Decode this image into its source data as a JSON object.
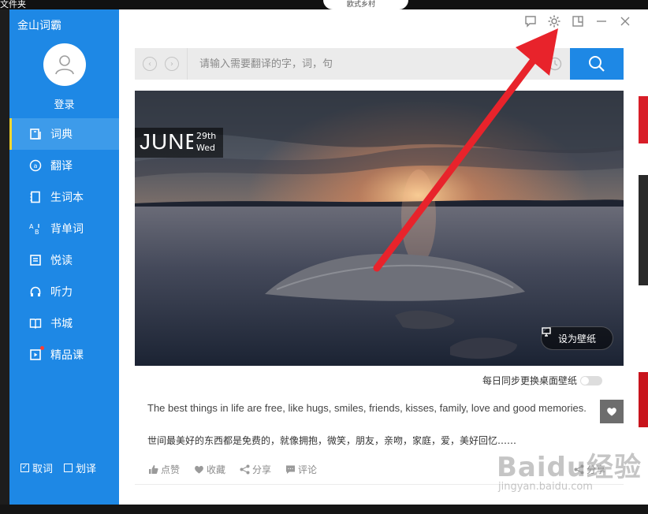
{
  "desktop": {
    "top_left_label": "文件夹",
    "top_tab_text": "欧式乡村"
  },
  "app": {
    "title": "金山词霸",
    "login_label": "登录",
    "nav_items": [
      {
        "label": "词典",
        "icon": "dictionary-icon",
        "active": true
      },
      {
        "label": "翻译",
        "icon": "translate-icon"
      },
      {
        "label": "生词本",
        "icon": "wordbook-icon"
      },
      {
        "label": "背单词",
        "icon": "memorize-icon"
      },
      {
        "label": "悦读",
        "icon": "reading-icon"
      },
      {
        "label": "听力",
        "icon": "headphones-icon"
      },
      {
        "label": "书城",
        "icon": "bookstore-icon"
      },
      {
        "label": "精品课",
        "icon": "course-icon"
      }
    ],
    "bottom_options": [
      {
        "label": "取词",
        "checked": true
      },
      {
        "label": "划译",
        "checked": false
      }
    ],
    "accent_color": "#1e88e5"
  },
  "search": {
    "placeholder": "请输入需要翻译的字，词，句"
  },
  "hero": {
    "month": "JUNE",
    "day": "29th",
    "weekday": "Wed",
    "wallpaper_button": "设为壁纸",
    "sync_label": "每日同步更换桌面壁纸"
  },
  "quote": {
    "english": "The best things in life are free, like hugs, smiles, friends, kisses, family, love and good memories.",
    "chinese": "世间最美好的东西都是免费的，就像拥抱，微笑，朋友，亲吻，家庭，爱，美好回忆……"
  },
  "actions": {
    "like": "点赞",
    "favorite": "收藏",
    "share": "分享",
    "comment": "评论",
    "more": "分享"
  },
  "watermark": {
    "logo": "Baidu经验",
    "url": "jingyan.baidu.com"
  }
}
